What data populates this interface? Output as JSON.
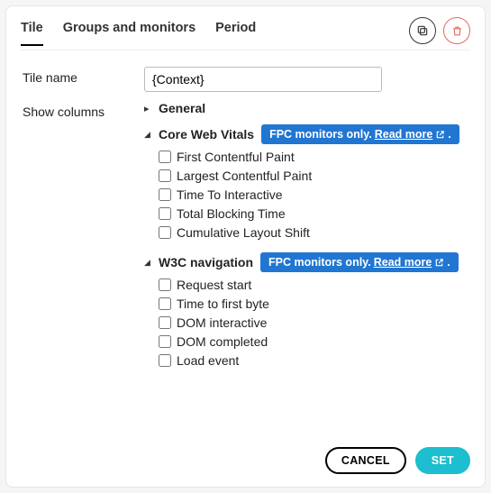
{
  "tabs": {
    "tile": "Tile",
    "groups": "Groups and monitors",
    "period": "Period"
  },
  "form": {
    "tileNameLabel": "Tile name",
    "tileNameValue": "{Context}",
    "showColumnsLabel": "Show columns"
  },
  "sections": {
    "general": {
      "title": "General"
    },
    "cwv": {
      "title": "Core Web Vitals",
      "badgePrefix": "FPC monitors only.",
      "badgeLink": "Read more",
      "items": [
        "First Contentful Paint",
        "Largest Contentful Paint",
        "Time To Interactive",
        "Total Blocking Time",
        "Cumulative Layout Shift"
      ]
    },
    "w3c": {
      "title": "W3C navigation",
      "badgePrefix": "FPC monitors only.",
      "badgeLink": "Read more",
      "items": [
        "Request start",
        "Time to first byte",
        "DOM interactive",
        "DOM completed",
        "Load event"
      ]
    }
  },
  "footer": {
    "cancel": "CANCEL",
    "set": "SET"
  },
  "badgeSuffix": "."
}
